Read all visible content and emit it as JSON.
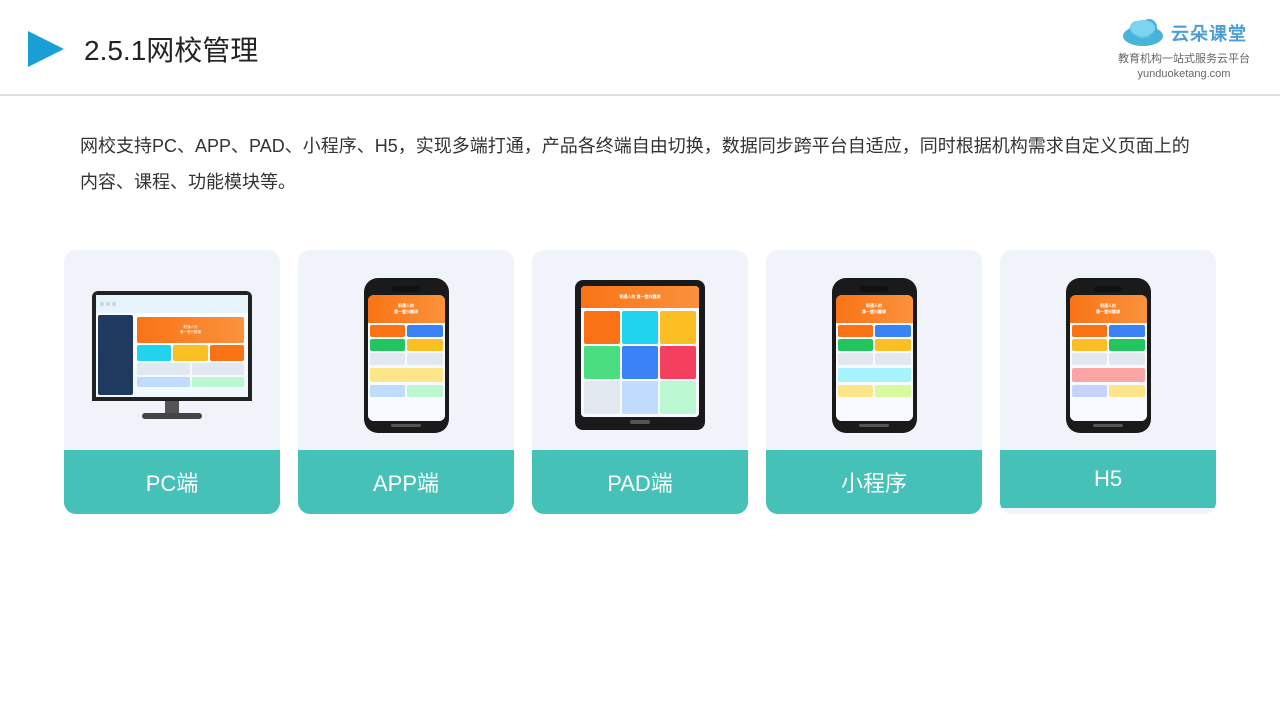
{
  "header": {
    "page_number": "2.5.1",
    "page_title": "网校管理",
    "brand_name": "云朵课堂",
    "brand_url": "yunduoketang.com",
    "brand_tagline": "教育机构一站式服务云平台"
  },
  "description": {
    "text": "网校支持PC、APP、PAD、小程序、H5，实现多端打通，产品各终端自由切换，数据同步跨平台自适应，同时根据机构需求自定义页面上的内容、课程、功能模块等。"
  },
  "cards": [
    {
      "label": "PC端",
      "type": "pc"
    },
    {
      "label": "APP端",
      "type": "phone"
    },
    {
      "label": "PAD端",
      "type": "tablet"
    },
    {
      "label": "小程序",
      "type": "phone"
    },
    {
      "label": "H5",
      "type": "phone"
    }
  ],
  "colors": {
    "accent": "#45c1b8",
    "title_accent": "#1a1a1a"
  }
}
